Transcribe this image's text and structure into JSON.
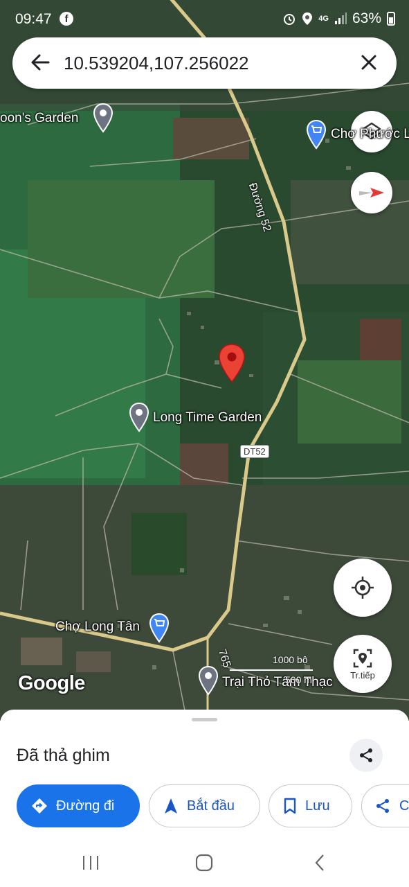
{
  "status_bar": {
    "time": "09:47",
    "network": "4G",
    "battery": "63%"
  },
  "search": {
    "query": "10.539204,107.256022"
  },
  "map": {
    "places": [
      {
        "name": "oon's Garden",
        "type": "place"
      },
      {
        "name": "Chợ Phước L",
        "type": "shopping"
      },
      {
        "name": "Long Time Garden",
        "type": "place"
      },
      {
        "name": "Chợ Long Tân",
        "type": "shopping"
      },
      {
        "name": "Trại Thỏ Tâm Thạc",
        "type": "place"
      }
    ],
    "roads": {
      "road_52": "Đường 52",
      "shield": "DT52",
      "road_765": "765"
    },
    "logo": "Google",
    "scale": {
      "imperial": "1000 bộ",
      "metric": "500 m"
    },
    "live_view_label": "Tr.tiếp",
    "colors": {
      "pin": "#ea4335",
      "road": "#d9c98a"
    }
  },
  "sheet": {
    "title": "Đã thả ghim",
    "actions": [
      {
        "label": "Đường đi",
        "icon": "directions-icon"
      },
      {
        "label": "Bắt đầu",
        "icon": "navigation-arrow-icon"
      },
      {
        "label": "Lưu",
        "icon": "bookmark-icon"
      },
      {
        "label": "C",
        "icon": "share-icon"
      }
    ]
  },
  "accent": "#1a73e8"
}
